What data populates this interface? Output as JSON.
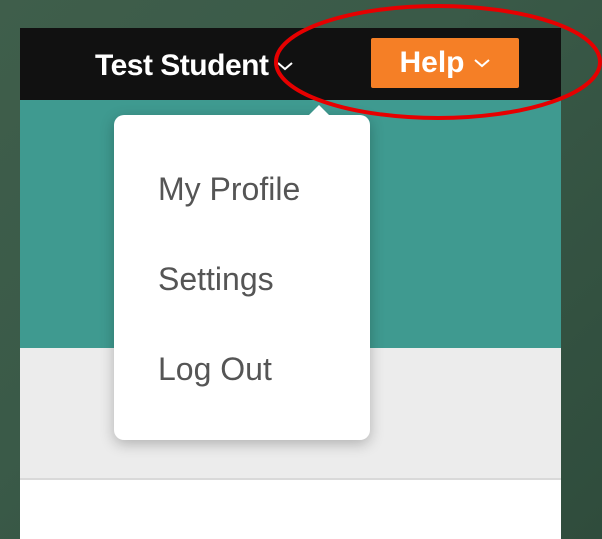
{
  "header": {
    "user_name": "Test Student",
    "help_label": "Help"
  },
  "user_dropdown": {
    "items": [
      {
        "label": "My Profile"
      },
      {
        "label": "Settings"
      },
      {
        "label": "Log Out"
      }
    ]
  },
  "colors": {
    "topbar": "#111111",
    "teal_band": "#3f9a90",
    "help_button": "#f57f26",
    "page_grey": "#ececec",
    "annotation": "#e60000"
  },
  "icons": {
    "user_menu_chevron": "chevron-down-icon",
    "help_chevron": "chevron-down-icon"
  }
}
